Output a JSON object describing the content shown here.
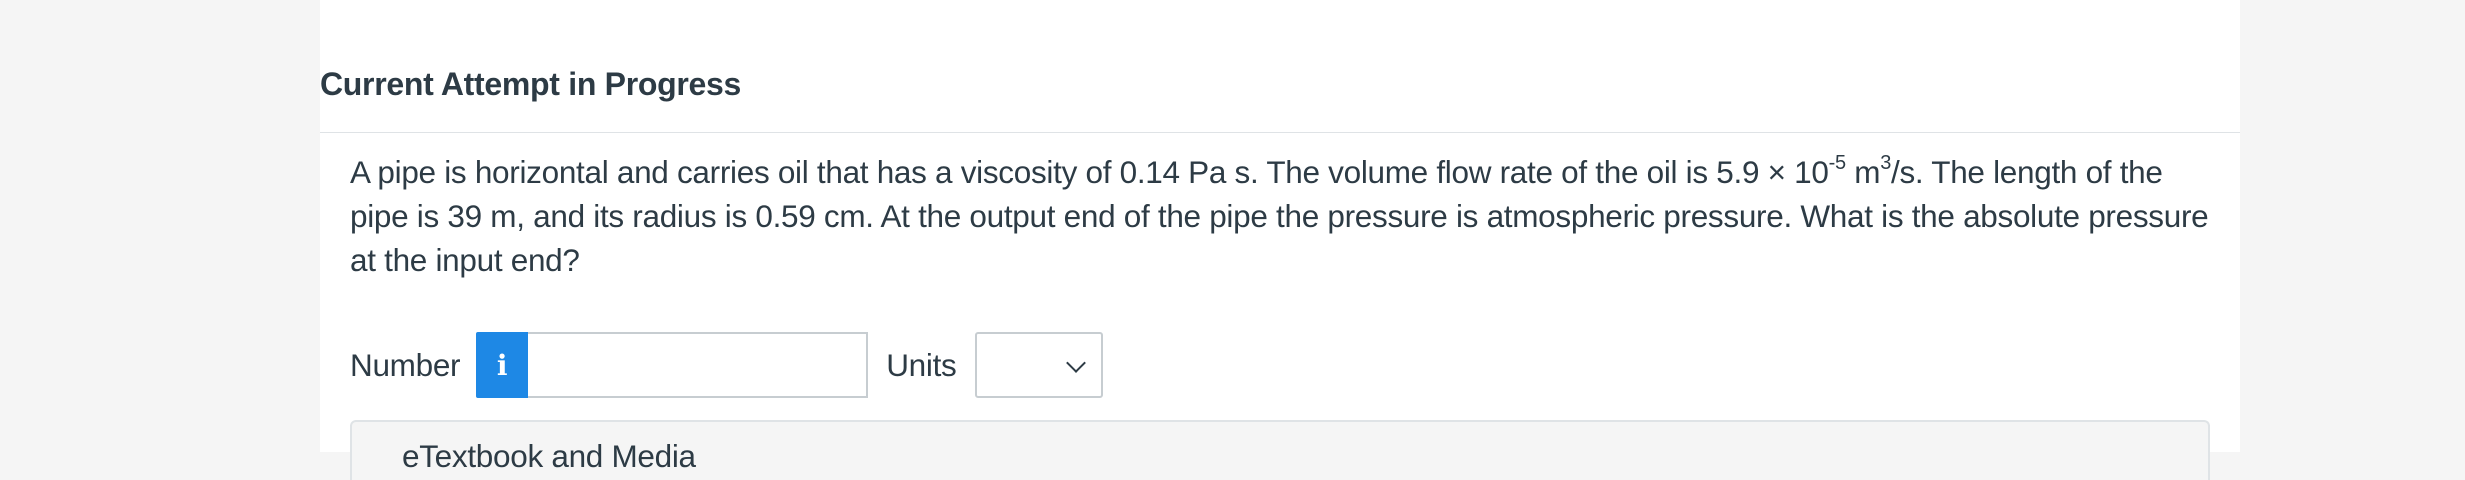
{
  "header": {
    "title": "Current Attempt in Progress"
  },
  "question": {
    "part1": "A pipe is horizontal and carries oil that has a viscosity of 0.14 Pa s. The volume flow rate of the oil is 5.9 × 10",
    "exponent1": "-5",
    "part2": " m",
    "exponent2": "3",
    "part3": "/s. The length of the pipe is 39 m, and its radius is 0.59 cm. At the output end of the pipe the pressure is atmospheric pressure. What is the absolute pressure at the input end?"
  },
  "answer": {
    "number_label": "Number",
    "info_glyph": "i",
    "number_value": "",
    "units_label": "Units",
    "units_selected": ""
  },
  "media_panel": {
    "title": "eTextbook and Media"
  }
}
